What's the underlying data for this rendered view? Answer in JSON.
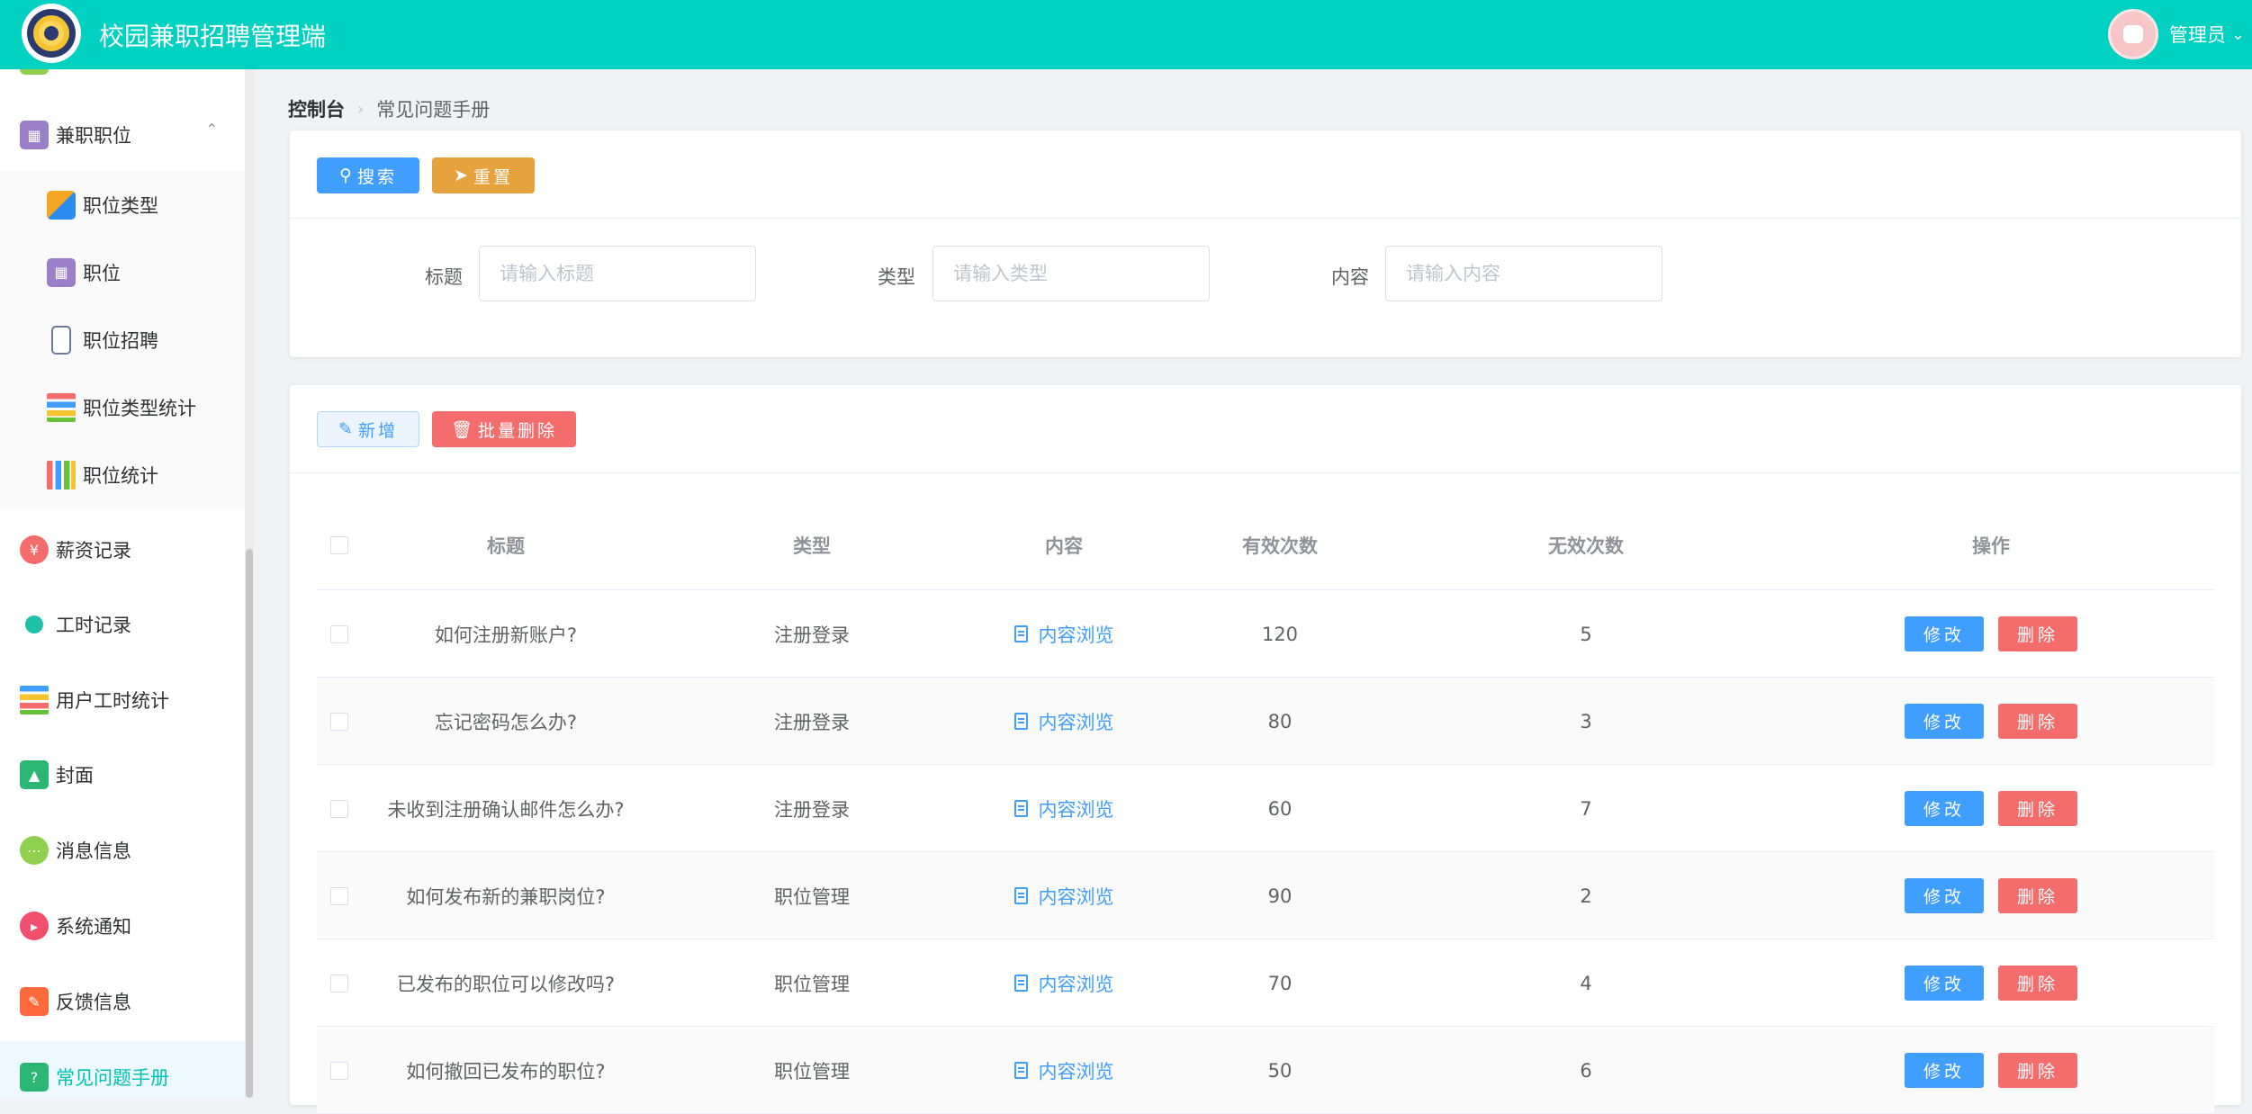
{
  "header": {
    "app_title": "校园兼职招聘管理端",
    "user_name": "管理员",
    "logo_icon": "magnifier-user-logo",
    "avatar_icon": "cartoon-avatar",
    "dropdown_icon": "chevron-down-icon",
    "brand_color": "#00d1c1"
  },
  "sidebar": {
    "group": {
      "label": "兼职职位",
      "icon": "id-card-icon",
      "expanded": true
    },
    "sub_items": [
      {
        "label": "职位类型",
        "icon": "cubes-icon"
      },
      {
        "label": "职位",
        "icon": "id-card-icon"
      },
      {
        "label": "职位招聘",
        "icon": "badge-icon"
      },
      {
        "label": "职位类型统计",
        "icon": "bar-list-icon"
      },
      {
        "label": "职位统计",
        "icon": "bar-chart-icon"
      }
    ],
    "items": [
      {
        "label": "薪资记录",
        "icon": "money-bag-icon"
      },
      {
        "label": "工时记录",
        "icon": "clock-icon"
      },
      {
        "label": "用户工时统计",
        "icon": "bar-list-icon"
      },
      {
        "label": "封面",
        "icon": "image-icon"
      },
      {
        "label": "消息信息",
        "icon": "chat-icon"
      },
      {
        "label": "系统通知",
        "icon": "megaphone-icon"
      },
      {
        "label": "反馈信息",
        "icon": "feedback-icon"
      },
      {
        "label": "常见问题手册",
        "icon": "question-icon",
        "active": true
      }
    ]
  },
  "breadcrumb": {
    "home": "控制台",
    "current": "常见问题手册"
  },
  "search": {
    "search_button": "搜索",
    "reset_button": "重置",
    "fields": [
      {
        "label": "标题",
        "placeholder": "请输入标题",
        "value": ""
      },
      {
        "label": "类型",
        "placeholder": "请输入类型",
        "value": ""
      },
      {
        "label": "内容",
        "placeholder": "请输入内容",
        "value": ""
      }
    ]
  },
  "toolbar": {
    "add_button": "新增",
    "batch_delete_button": "批量删除"
  },
  "table": {
    "columns": [
      "标题",
      "类型",
      "内容",
      "有效次数",
      "无效次数",
      "操作"
    ],
    "content_link": "内容浏览",
    "edit_button": "修改",
    "delete_button": "删除",
    "rows": [
      {
        "title": "如何注册新账户?",
        "type": "注册登录",
        "valid": "120",
        "invalid": "5"
      },
      {
        "title": "忘记密码怎么办?",
        "type": "注册登录",
        "valid": "80",
        "invalid": "3"
      },
      {
        "title": "未收到注册确认邮件怎么办?",
        "type": "注册登录",
        "valid": "60",
        "invalid": "7"
      },
      {
        "title": "如何发布新的兼职岗位?",
        "type": "职位管理",
        "valid": "90",
        "invalid": "2"
      },
      {
        "title": "已发布的职位可以修改吗?",
        "type": "职位管理",
        "valid": "70",
        "invalid": "4"
      },
      {
        "title": "如何撤回已发布的职位?",
        "type": "职位管理",
        "valid": "50",
        "invalid": "6"
      }
    ]
  },
  "colors": {
    "primary": "#409eff",
    "warning": "#e6a23c",
    "danger": "#f56c6c",
    "active_menu_text": "#00c2b3"
  }
}
